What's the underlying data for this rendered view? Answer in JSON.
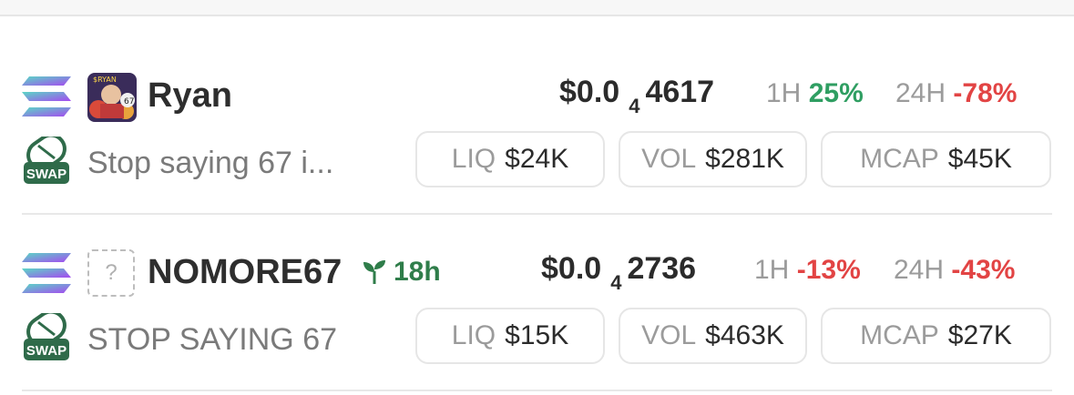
{
  "colors": {
    "up": "#2f9e62",
    "down": "#e24444",
    "muted": "#9b9b9b",
    "age": "#2f7d4a"
  },
  "tokens": [
    {
      "chain_icon": "solana-icon",
      "avatar_icon": "token-avatar-image",
      "name": "Ryan",
      "price_prefix": "$0.0",
      "price_zeros": "4",
      "price_digits": "4617",
      "h1_label": "1H",
      "h1_change": "25%",
      "h24_label": "24H",
      "h24_change": "-78%",
      "swap_icon": "swap-pill-icon",
      "description": "Stop saying 67 i...",
      "liq_label": "LIQ",
      "liq_value": "$24K",
      "vol_label": "VOL",
      "vol_value": "$281K",
      "mcap_label": "MCAP",
      "mcap_value": "$45K"
    },
    {
      "chain_icon": "solana-icon",
      "avatar_icon": "question-mark-icon",
      "avatar_text": "?",
      "name": "NOMORE67",
      "age_icon": "sprout-icon",
      "age": "18h",
      "price_prefix": "$0.0",
      "price_zeros": "4",
      "price_digits": "2736",
      "h1_label": "1H",
      "h1_change": "-13%",
      "h24_label": "24H",
      "h24_change": "-43%",
      "swap_icon": "swap-pill-icon",
      "description": "STOP SAYING 67",
      "liq_label": "LIQ",
      "liq_value": "$15K",
      "vol_label": "VOL",
      "vol_value": "$463K",
      "mcap_label": "MCAP",
      "mcap_value": "$27K"
    }
  ]
}
